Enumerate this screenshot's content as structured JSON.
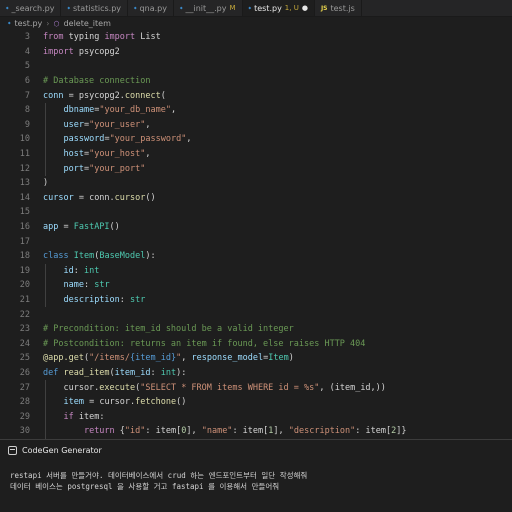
{
  "tabs": [
    {
      "label": "_search.py",
      "icon": "python-icon",
      "active": false,
      "status": ""
    },
    {
      "label": "statistics.py",
      "icon": "python-icon",
      "active": false,
      "status": ""
    },
    {
      "label": "qna.py",
      "icon": "python-icon",
      "active": false,
      "status": ""
    },
    {
      "label": "__init__.py",
      "icon": "python-icon",
      "active": false,
      "status": "M"
    },
    {
      "label": "test.py",
      "icon": "python-icon",
      "active": true,
      "status": "1, U"
    },
    {
      "label": "test.js",
      "icon": "javascript-icon",
      "active": false,
      "status": ""
    }
  ],
  "breadcrumb": {
    "file": "test.py",
    "symbol": "delete_item"
  },
  "editor": {
    "lines": [
      {
        "n": "3",
        "tokens": [
          [
            "kw",
            "from"
          ],
          [
            "plain",
            " typing "
          ],
          [
            "kw",
            "import"
          ],
          [
            "plain",
            " List"
          ]
        ]
      },
      {
        "n": "4",
        "tokens": [
          [
            "kw",
            "import"
          ],
          [
            "plain",
            " psycopg2"
          ]
        ]
      },
      {
        "n": "5",
        "tokens": []
      },
      {
        "n": "6",
        "tokens": [
          [
            "com",
            "# Database connection"
          ]
        ]
      },
      {
        "n": "7",
        "tokens": [
          [
            "var",
            "conn"
          ],
          [
            "plain",
            " = psycopg2."
          ],
          [
            "fnc",
            "connect"
          ],
          [
            "plain",
            "("
          ]
        ]
      },
      {
        "n": "8",
        "tokens": [
          [
            "plain",
            "    "
          ],
          [
            "var",
            "dbname"
          ],
          [
            "plain",
            "="
          ],
          [
            "str",
            "\"your_db_name\""
          ],
          [
            "plain",
            ","
          ]
        ]
      },
      {
        "n": "9",
        "tokens": [
          [
            "plain",
            "    "
          ],
          [
            "var",
            "user"
          ],
          [
            "plain",
            "="
          ],
          [
            "str",
            "\"your_user\""
          ],
          [
            "plain",
            ","
          ]
        ]
      },
      {
        "n": "10",
        "tokens": [
          [
            "plain",
            "    "
          ],
          [
            "var",
            "password"
          ],
          [
            "plain",
            "="
          ],
          [
            "str",
            "\"your_password\""
          ],
          [
            "plain",
            ","
          ]
        ]
      },
      {
        "n": "11",
        "tokens": [
          [
            "plain",
            "    "
          ],
          [
            "var",
            "host"
          ],
          [
            "plain",
            "="
          ],
          [
            "str",
            "\"your_host\""
          ],
          [
            "plain",
            ","
          ]
        ]
      },
      {
        "n": "12",
        "tokens": [
          [
            "plain",
            "    "
          ],
          [
            "var",
            "port"
          ],
          [
            "plain",
            "="
          ],
          [
            "str",
            "\"your_port\""
          ]
        ]
      },
      {
        "n": "13",
        "tokens": [
          [
            "plain",
            ")"
          ]
        ]
      },
      {
        "n": "14",
        "tokens": [
          [
            "var",
            "cursor"
          ],
          [
            "plain",
            " = conn."
          ],
          [
            "fnc",
            "cursor"
          ],
          [
            "plain",
            "()"
          ]
        ]
      },
      {
        "n": "15",
        "tokens": []
      },
      {
        "n": "16",
        "tokens": [
          [
            "var",
            "app"
          ],
          [
            "plain",
            " = "
          ],
          [
            "cls",
            "FastAPI"
          ],
          [
            "plain",
            "()"
          ]
        ]
      },
      {
        "n": "17",
        "tokens": []
      },
      {
        "n": "18",
        "tokens": [
          [
            "kw2",
            "class"
          ],
          [
            "plain",
            " "
          ],
          [
            "cls",
            "Item"
          ],
          [
            "plain",
            "("
          ],
          [
            "cls",
            "BaseModel"
          ],
          [
            "plain",
            "):"
          ]
        ]
      },
      {
        "n": "19",
        "tokens": [
          [
            "plain",
            "    "
          ],
          [
            "var",
            "id"
          ],
          [
            "plain",
            ": "
          ],
          [
            "cls",
            "int"
          ]
        ]
      },
      {
        "n": "20",
        "tokens": [
          [
            "plain",
            "    "
          ],
          [
            "var",
            "name"
          ],
          [
            "plain",
            ": "
          ],
          [
            "cls",
            "str"
          ]
        ]
      },
      {
        "n": "21",
        "tokens": [
          [
            "plain",
            "    "
          ],
          [
            "var",
            "description"
          ],
          [
            "plain",
            ": "
          ],
          [
            "cls",
            "str"
          ]
        ]
      },
      {
        "n": "22",
        "tokens": []
      },
      {
        "n": "23",
        "tokens": [
          [
            "com",
            "# Precondition: item_id should be a valid integer"
          ]
        ]
      },
      {
        "n": "24",
        "tokens": [
          [
            "com",
            "# Postcondition: returns an item if found, else raises HTTP 404"
          ]
        ]
      },
      {
        "n": "25",
        "tokens": [
          [
            "dec",
            "@app.get"
          ],
          [
            "plain",
            "("
          ],
          [
            "str",
            "\"/items/"
          ],
          [
            "kw2",
            "{item_id}"
          ],
          [
            "str",
            "\""
          ],
          [
            "plain",
            ", "
          ],
          [
            "var",
            "response_model"
          ],
          [
            "plain",
            "="
          ],
          [
            "cls",
            "Item"
          ],
          [
            "plain",
            ")"
          ]
        ]
      },
      {
        "n": "26",
        "tokens": [
          [
            "kw2",
            "def"
          ],
          [
            "plain",
            " "
          ],
          [
            "fnc",
            "read_item"
          ],
          [
            "plain",
            "("
          ],
          [
            "var",
            "item_id"
          ],
          [
            "plain",
            ": "
          ],
          [
            "cls",
            "int"
          ],
          [
            "plain",
            "):"
          ]
        ]
      },
      {
        "n": "27",
        "tokens": [
          [
            "plain",
            "    cursor."
          ],
          [
            "fnc",
            "execute"
          ],
          [
            "plain",
            "("
          ],
          [
            "str",
            "\"SELECT * FROM items WHERE id = %s\""
          ],
          [
            "plain",
            ", (item_id,))"
          ]
        ]
      },
      {
        "n": "28",
        "tokens": [
          [
            "plain",
            "    "
          ],
          [
            "var",
            "item"
          ],
          [
            "plain",
            " = cursor."
          ],
          [
            "fnc",
            "fetchone"
          ],
          [
            "plain",
            "()"
          ]
        ]
      },
      {
        "n": "29",
        "tokens": [
          [
            "plain",
            "    "
          ],
          [
            "kw",
            "if"
          ],
          [
            "plain",
            " item:"
          ]
        ]
      },
      {
        "n": "30",
        "tokens": [
          [
            "plain",
            "        "
          ],
          [
            "kw",
            "return"
          ],
          [
            "plain",
            " {"
          ],
          [
            "str",
            "\"id\""
          ],
          [
            "plain",
            ": item["
          ],
          [
            "num",
            "0"
          ],
          [
            "plain",
            "], "
          ],
          [
            "str",
            "\"name\""
          ],
          [
            "plain",
            ": item["
          ],
          [
            "num",
            "1"
          ],
          [
            "plain",
            "], "
          ],
          [
            "str",
            "\"description\""
          ],
          [
            "plain",
            ": item["
          ],
          [
            "num",
            "2"
          ],
          [
            "plain",
            "]}"
          ]
        ]
      }
    ]
  },
  "panel": {
    "title": "CodeGen Generator",
    "messages": [
      "restapi 서버를 만들거야. 데이터베이스에서 crud 하는 엔드포인트부터 일단 작성해줘",
      "데이터 베이스는 postgresql 을 사용할 거고 fastapi 를 이용해서 만들어줘"
    ]
  }
}
